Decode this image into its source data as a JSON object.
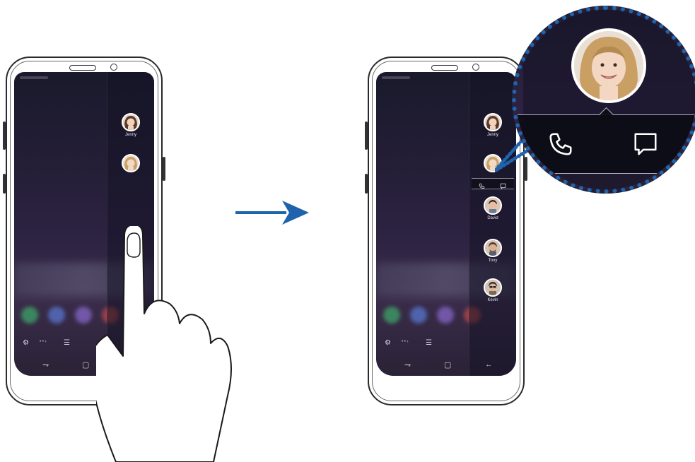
{
  "colors": {
    "accent": "#1f63ad",
    "screen": "#2d2342",
    "border": "#2a2a2a"
  },
  "left_phone": {
    "contacts": [
      {
        "name": "Jenny",
        "icon": "woman-brunette-avatar"
      },
      {
        "name": "",
        "icon": "woman-blonde-avatar"
      }
    ],
    "gesture_icon": "finger-tap"
  },
  "arrow_icon": "right-arrow",
  "right_phone": {
    "contacts": [
      {
        "name": "Jenny",
        "icon": "woman-brunette-avatar"
      },
      {
        "name": "",
        "icon": "woman-blonde-avatar"
      },
      {
        "name": "David",
        "icon": "man-smiling-avatar"
      },
      {
        "name": "Tony",
        "icon": "man-beard-avatar"
      },
      {
        "name": "Kevin",
        "icon": "man-sunglasses-avatar"
      }
    ],
    "actions": [
      {
        "name": "call",
        "icon": "phone-icon"
      },
      {
        "name": "message",
        "icon": "message-icon"
      }
    ]
  },
  "zoom": {
    "contact_icon": "woman-blonde-avatar",
    "actions": [
      {
        "name": "call",
        "icon": "phone-icon"
      },
      {
        "name": "message",
        "icon": "message-icon"
      }
    ]
  },
  "navbar": {
    "icons": [
      "recents-icon",
      "home-icon",
      "back-icon"
    ]
  },
  "bottom_tools": {
    "icons": [
      "gear-icon",
      "page-dots-icon",
      "list-icon"
    ]
  }
}
